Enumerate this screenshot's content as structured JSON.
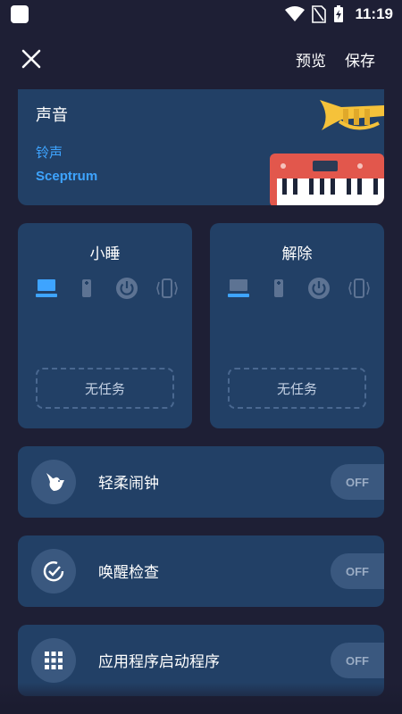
{
  "status_bar": {
    "time": "11:19"
  },
  "top_bar": {
    "preview_label": "预览",
    "save_label": "保存"
  },
  "sound": {
    "title": "声音",
    "ringtone_label": "铃声",
    "ringtone_name": "Sceptrum"
  },
  "snooze": {
    "title": "小睡",
    "no_task_label": "无任务"
  },
  "dismiss": {
    "title": "解除",
    "no_task_label": "无任务"
  },
  "features": [
    {
      "label": "轻柔闹钟",
      "toggle": "OFF",
      "icon": "bird-icon"
    },
    {
      "label": "唤醒检查",
      "toggle": "OFF",
      "icon": "check-circle-icon"
    },
    {
      "label": "应用程序启动程序",
      "toggle": "OFF",
      "icon": "app-grid-icon"
    }
  ],
  "colors": {
    "background": "#1e1f35",
    "card": "#224066",
    "accent": "#3ea4ff",
    "icon_inactive": "#5d7393"
  }
}
